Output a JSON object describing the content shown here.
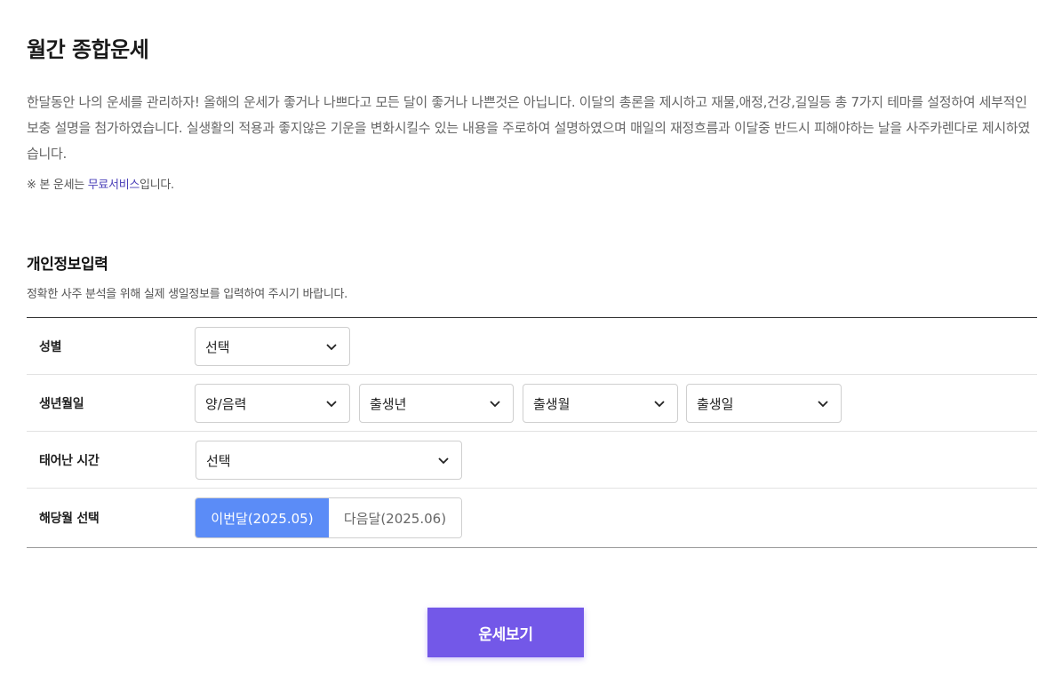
{
  "page": {
    "title": "월간 종합운세",
    "intro": "한달동안 나의 운세를 관리하자! 올해의 운세가 좋거나 나쁘다고 모든 달이 좋거나 나쁜것은 아닙니다. 이달의 총론을 제시하고 재물,애정,건강,길일등 총 7가지 테마를 설정하여 세부적인 보충 설명을 첨가하였습니다. 실생활의 적용과 좋지않은 기운을 변화시킬수 있는 내용을 주로하여 설명하였으며 매일의 재정흐름과 이달중 반드시 피해야하는 날을 사주카렌다로 제시하였습니다.",
    "notice_prefix": "※ 본 운세는 ",
    "notice_highlight": "무료서비스",
    "notice_suffix": "입니다."
  },
  "form": {
    "title": "개인정보입력",
    "description": "정확한 사주 분석을 위해 실제 생일정보를 입력하여 주시기 바랍니다.",
    "gender": {
      "label": "성별",
      "value": "선택"
    },
    "birth": {
      "label": "생년월일",
      "calendar": "양/음력",
      "year": "출생년",
      "month": "출생월",
      "day": "출생일"
    },
    "birth_time": {
      "label": "태어난 시간",
      "value": "선택"
    },
    "month_select": {
      "label": "해당월 선택",
      "options": [
        "이번달(2025.05)",
        "다음달(2025.06)"
      ],
      "selected": "이번달(2025.05)"
    },
    "submit_label": "운세보기"
  },
  "colors": {
    "accent_purple": "#7358e8",
    "active_blue": "#5b8cf7",
    "highlight_text": "#4a3fb8"
  },
  "icons": {
    "dropdown": "chevron-down-icon"
  }
}
